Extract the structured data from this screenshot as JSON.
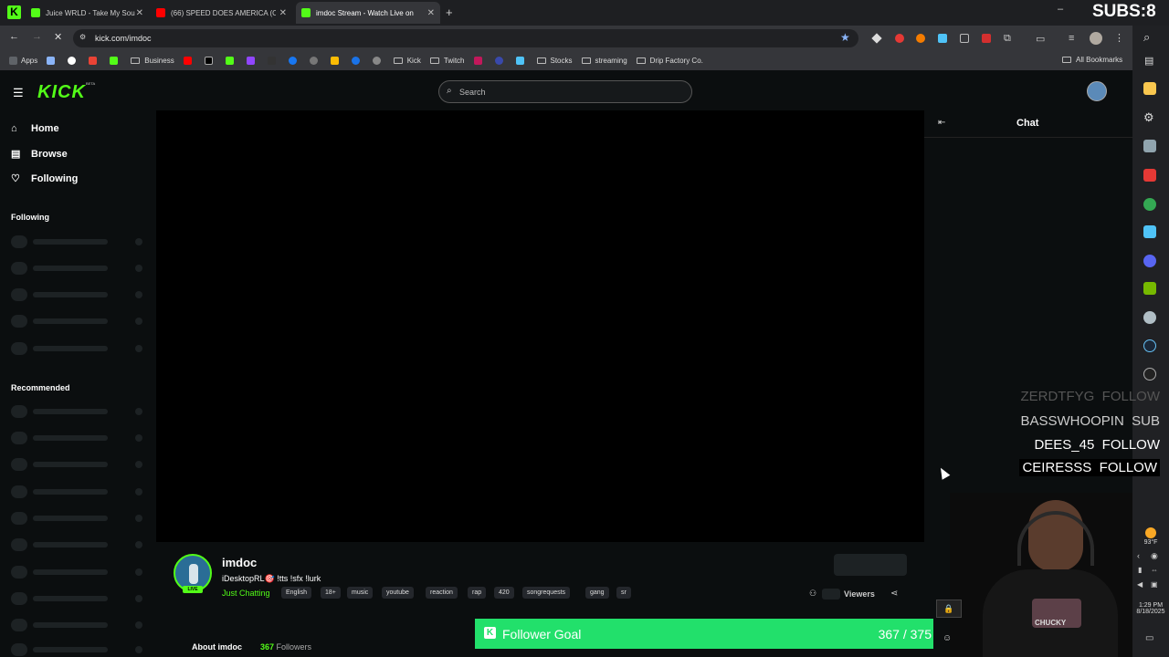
{
  "tabs": [
    {
      "label": "Juice WRLD - Take My Sou",
      "color": "#53fc18"
    },
    {
      "label": "(66) SPEED DOES AMERICA (OF",
      "color": "#ff0000"
    },
    {
      "label": "imdoc Stream - Watch Live on",
      "color": "#53fc18"
    }
  ],
  "overlay_counter": "SUBS:8",
  "address": {
    "url": "kick.com/imdoc"
  },
  "bookmarks": [
    {
      "label": "Apps",
      "icon": "apps-grid-icon"
    },
    {
      "label": "Business",
      "icon": "folder-icon"
    },
    {
      "label": "Kick",
      "icon": "folder-icon"
    },
    {
      "label": "Twitch",
      "icon": "folder-icon"
    },
    {
      "label": "Stocks",
      "icon": "folder-icon"
    },
    {
      "label": "streaming",
      "icon": "folder-icon"
    },
    {
      "label": "Drip Factory Co.",
      "icon": "folder-icon"
    }
  ],
  "all_bookmarks": "All Bookmarks",
  "kick": {
    "logo": "KICK",
    "beta": "BETA",
    "search_placeholder": "Search",
    "nav": [
      {
        "label": "Home",
        "icon": "home-icon"
      },
      {
        "label": "Browse",
        "icon": "browse-icon"
      },
      {
        "label": "Following",
        "icon": "heart-icon"
      }
    ],
    "following_title": "Following",
    "recommended_title": "Recommended",
    "chat_title": "Chat"
  },
  "channel": {
    "name": "imdoc",
    "live": "LIVE",
    "title": "iDesktopRL🎯 !tts !sfx !lurk",
    "category": "Just Chatting",
    "tags": [
      "English",
      "18+",
      "music",
      "youtube",
      "reaction",
      "rap",
      "420",
      "songrequests",
      "gang",
      "sr"
    ],
    "viewers_label": "Viewers",
    "about": "About imdoc",
    "followers_count": "367",
    "followers_label": "Followers"
  },
  "goal": {
    "label": "Follower Goal",
    "count": "367 / 375",
    "progress": 0.9787
  },
  "alerts": [
    {
      "name": "ZERDTFYG",
      "action": "FOLLOW"
    },
    {
      "name": "BASSWHOOPIN",
      "action": "SUB"
    },
    {
      "name": "DEES_45",
      "action": "FOLLOW"
    },
    {
      "name": "CEIRESSS",
      "action": "FOLLOW"
    }
  ],
  "webcam_shirt": "CHUCKY",
  "taskbar": {
    "temp": "93°F",
    "time": "1:29 PM",
    "date": "8/18/2025"
  },
  "colors": {
    "kick_green": "#53fc18",
    "goal_green": "#22e06b",
    "bg": "#0b0e0f"
  }
}
